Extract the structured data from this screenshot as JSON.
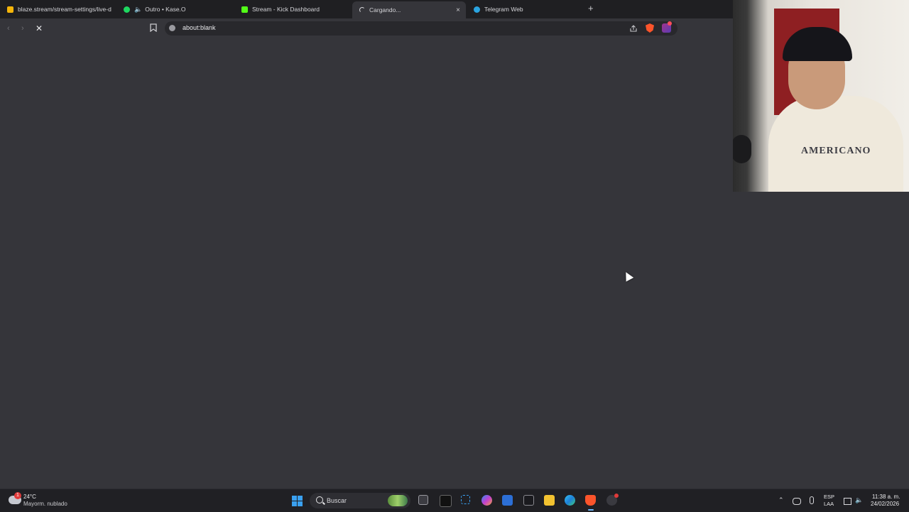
{
  "browser": {
    "tabs": [
      {
        "label": "blaze.stream/stream-settings/live-d",
        "favicon_color": "#f5b50a",
        "icon": "blaze-icon"
      },
      {
        "label": "Outro • Kase.O",
        "favicon_color": "#1ed760",
        "icon": "spotify-icon",
        "audio": true
      },
      {
        "label": "Stream - Kick Dashboard",
        "favicon_color": "#53fc18",
        "icon": "kick-icon"
      },
      {
        "label": "Cargando...",
        "favicon_color": "#d4d4d8",
        "icon": "loading-spinner-icon",
        "active": true
      },
      {
        "label": "Telegram Web",
        "favicon_color": "#2aa4e0",
        "icon": "telegram-icon"
      }
    ],
    "new_tab_symbol": "+",
    "close_symbol": "×",
    "url": "about:blank"
  },
  "taskbar": {
    "weather": {
      "badge": "1",
      "temp": "24°C",
      "desc": "Mayorm. nublado"
    },
    "search_placeholder": "Buscar",
    "language": {
      "line1": "ESP",
      "line2": "LAA"
    },
    "clock": {
      "time": "11:38 a. m.",
      "date": "24/02/2026"
    }
  },
  "webcam": {
    "shirt_text": "AMERICANO"
  }
}
